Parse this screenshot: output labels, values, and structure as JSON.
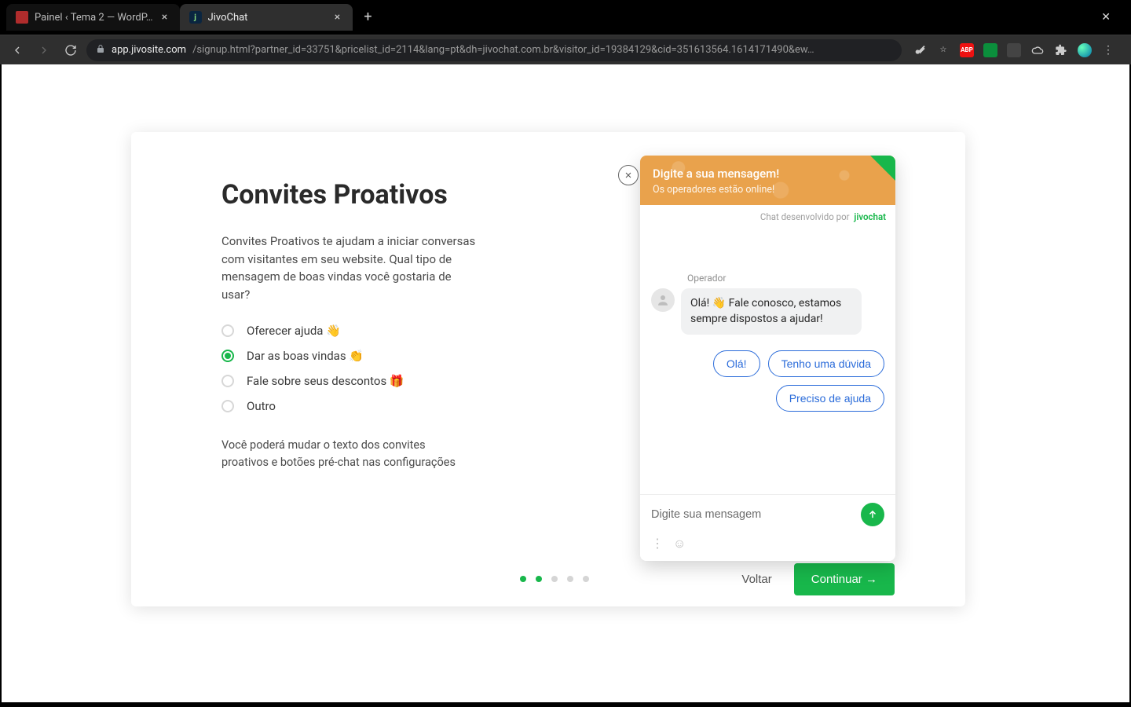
{
  "browser": {
    "tabs": [
      {
        "title": "Painel ‹ Tema 2 — WordP…"
      },
      {
        "title": "JivoChat"
      }
    ],
    "url_host": "app.jivosite.com",
    "url_path": "/signup.html?partner_id=33751&pricelist_id=2114&lang=pt&dh=jivochat.com.br&visitor_id=19384129&cid=351613564.1614171490&ew…",
    "ext_abp": "ABP"
  },
  "page": {
    "title": "Convites Proativos",
    "description": "Convites Proativos te ajudam a iniciar conversas com visitantes em seu website. Qual tipo de mensagem de boas vindas você gostaria de usar?",
    "options": [
      {
        "label": "Oferecer ajuda 👋",
        "selected": false
      },
      {
        "label": "Dar as boas vindas 👏",
        "selected": true
      },
      {
        "label": "Fale sobre seus descontos 🎁",
        "selected": false
      },
      {
        "label": "Outro",
        "selected": false
      }
    ],
    "note": "Você poderá mudar o texto dos convites proativos e botões pré-chat nas configurações",
    "back_label": "Voltar",
    "continue_label": "Continuar →",
    "step_active_index": 1,
    "step_count": 5
  },
  "chat": {
    "header_title": "Digite a sua mensagem!",
    "header_sub": "Os operadores estão online!",
    "powered_prefix": "Chat desenvolvido por",
    "powered_brand": "jivochat",
    "operator_label": "Operador",
    "message": "Olá! 👋 Fale conosco, estamos sempre dispostos a ajudar!",
    "quick_replies": [
      "Olá!",
      "Tenho uma dúvida",
      "Preciso de ajuda"
    ],
    "input_placeholder": "Digite sua mensagem"
  }
}
